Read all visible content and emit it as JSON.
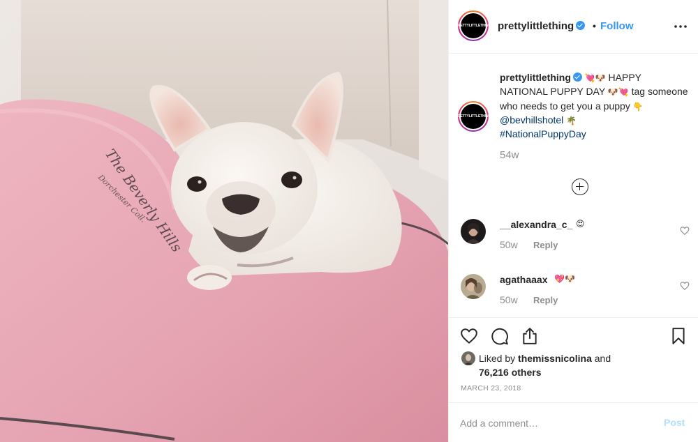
{
  "header": {
    "avatar_text": "PRETTYLITTLETHING",
    "username": "prettylittlething",
    "separator": "•",
    "follow_label": "Follow",
    "more_icon": "more-horizontal-icon"
  },
  "photo": {
    "pillow_embroidery_line1": "The Beverly Hills",
    "pillow_embroidery_line2": "Dorchester Coll."
  },
  "caption": {
    "avatar_text": "PRETTYLITTLETHING",
    "username": "prettylittlething",
    "emoji_1": "💘🐶",
    "text_1": " HAPPY NATIONAL PUPPY DAY ",
    "emoji_2": "🐶💘",
    "text_2": " tag someone who needs to get you a puppy ",
    "emoji_3": "👇",
    "mention": "@bevhillshotel",
    "emoji_4": "🌴",
    "hashtag": "#NationalPuppyDay",
    "time": "54w"
  },
  "load_more_icon": "plus-circle-icon",
  "comments": [
    {
      "username": "__alexandra_c_",
      "emoji": "😍",
      "time": "50w",
      "reply_label": "Reply"
    },
    {
      "username": "agathaaax",
      "emoji": "💖🐶",
      "time": "50w",
      "reply_label": "Reply"
    }
  ],
  "actions": {
    "like_icon": "heart-icon",
    "comment_icon": "comment-icon",
    "share_icon": "share-icon",
    "save_icon": "bookmark-icon"
  },
  "likes": {
    "prefix": "Liked by ",
    "user": "themissnicolina",
    "middle": " and",
    "count": "76,216 others"
  },
  "date": "MARCH 23, 2018",
  "comment_box": {
    "placeholder": "Add a comment…",
    "post_label": "Post"
  },
  "colors": {
    "accent": "#3897f0",
    "link": "#003569",
    "muted": "#8e8e8e",
    "post_disabled": "#b2dffc",
    "pillow": "#e7a9b6"
  }
}
